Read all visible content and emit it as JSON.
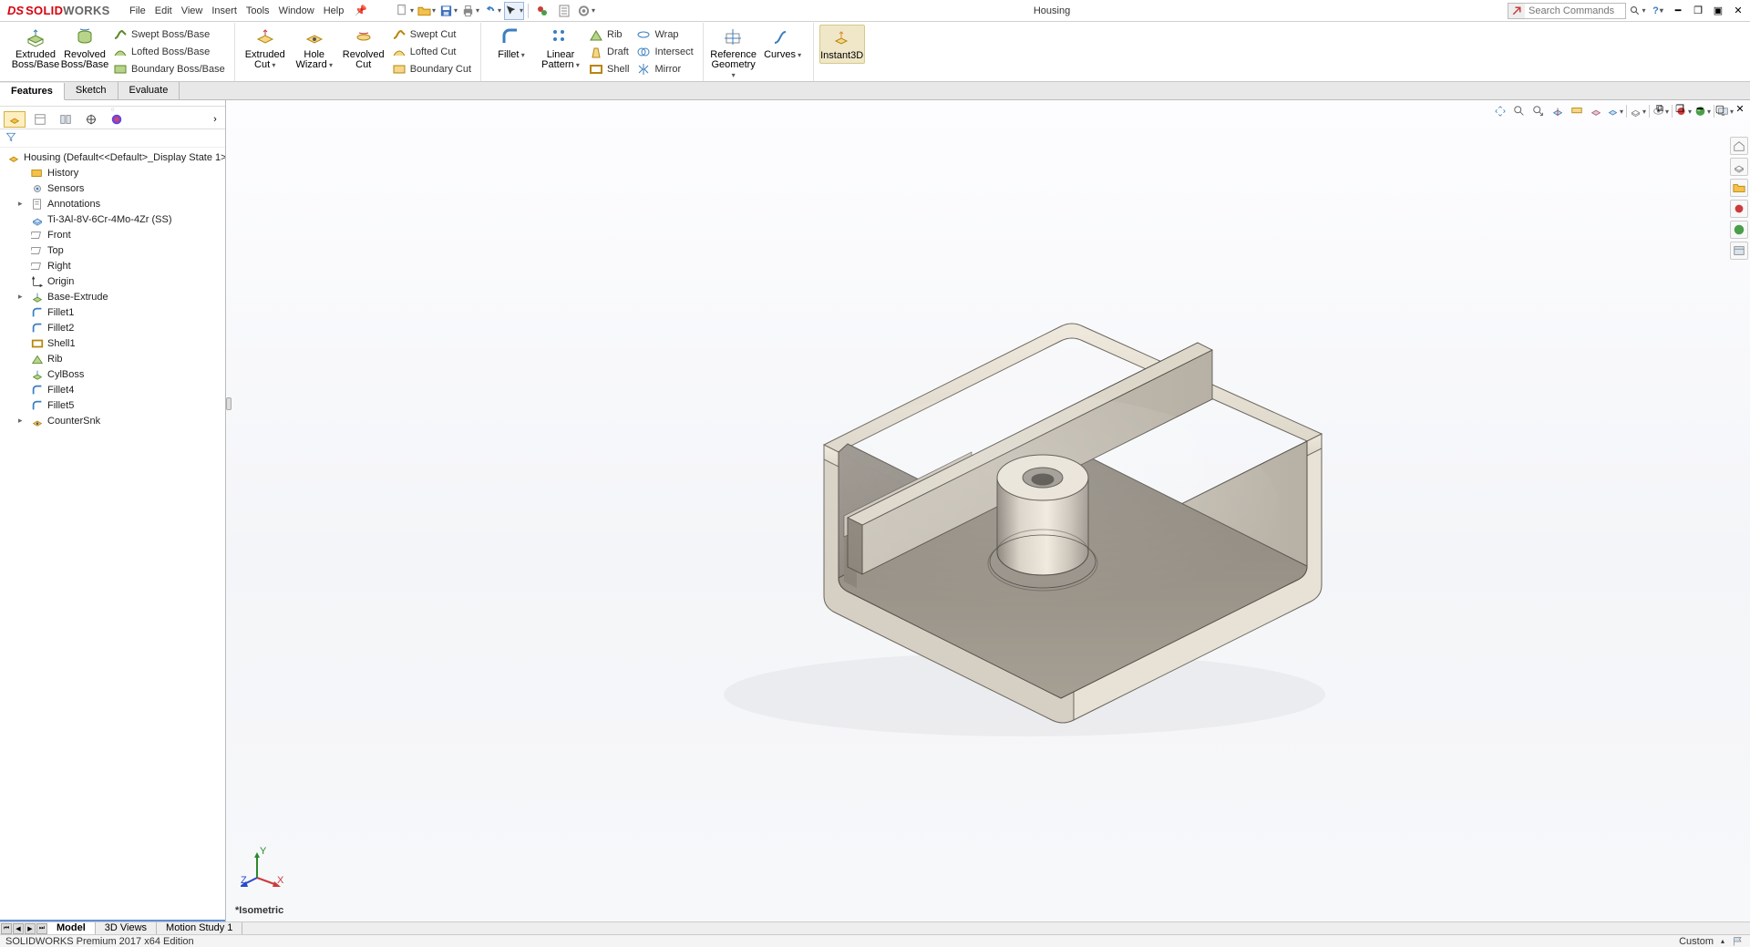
{
  "app": {
    "brand_ds": "DS",
    "brand_solid": "SOLID",
    "brand_works": "WORKS",
    "title": "Housing"
  },
  "menu": {
    "file": "File",
    "edit": "Edit",
    "view": "View",
    "insert": "Insert",
    "tools": "Tools",
    "window": "Window",
    "help": "Help"
  },
  "search": {
    "placeholder": "Search Commands"
  },
  "ribbon": {
    "extr_boss": "Extruded Boss/Base",
    "rev_boss": "Revolved Boss/Base",
    "swept_boss": "Swept Boss/Base",
    "lofted_boss": "Lofted Boss/Base",
    "boundary_boss": "Boundary Boss/Base",
    "extr_cut": "Extruded Cut",
    "hole_wiz": "Hole Wizard",
    "rev_cut": "Revolved Cut",
    "swept_cut": "Swept Cut",
    "lofted_cut": "Lofted Cut",
    "boundary_cut": "Boundary Cut",
    "fillet": "Fillet",
    "linpat": "Linear Pattern",
    "rib": "Rib",
    "draft": "Draft",
    "shell": "Shell",
    "wrap": "Wrap",
    "intersect": "Intersect",
    "mirror": "Mirror",
    "refgeo": "Reference Geometry",
    "curves": "Curves",
    "instant3d": "Instant3D"
  },
  "tabs": {
    "features": "Features",
    "sketch": "Sketch",
    "evaluate": "Evaluate"
  },
  "tree": {
    "root": "Housing  (Default<<Default>_Display State 1>)",
    "items": [
      {
        "icon": "folder",
        "label": "History"
      },
      {
        "icon": "sensor",
        "label": "Sensors"
      },
      {
        "icon": "note",
        "label": "Annotations",
        "exp": true
      },
      {
        "icon": "material",
        "label": "Ti-3Al-8V-6Cr-4Mo-4Zr (SS)"
      },
      {
        "icon": "plane",
        "label": "Front"
      },
      {
        "icon": "plane",
        "label": "Top"
      },
      {
        "icon": "plane",
        "label": "Right"
      },
      {
        "icon": "origin",
        "label": "Origin"
      },
      {
        "icon": "extrude",
        "label": "Base-Extrude",
        "exp": true
      },
      {
        "icon": "fillet",
        "label": "Fillet1"
      },
      {
        "icon": "fillet",
        "label": "Fillet2"
      },
      {
        "icon": "shell",
        "label": "Shell1"
      },
      {
        "icon": "rib",
        "label": "Rib"
      },
      {
        "icon": "extrude",
        "label": "CylBoss"
      },
      {
        "icon": "fillet",
        "label": "Fillet4"
      },
      {
        "icon": "fillet",
        "label": "Fillet5"
      },
      {
        "icon": "hole",
        "label": "CounterSnk",
        "exp": true
      }
    ]
  },
  "view": {
    "iso": "*Isometric"
  },
  "btabs": {
    "model": "Model",
    "views3d": "3D Views",
    "motion": "Motion Study 1"
  },
  "status": {
    "edition": "SOLIDWORKS Premium 2017 x64 Edition",
    "units": "Custom"
  }
}
